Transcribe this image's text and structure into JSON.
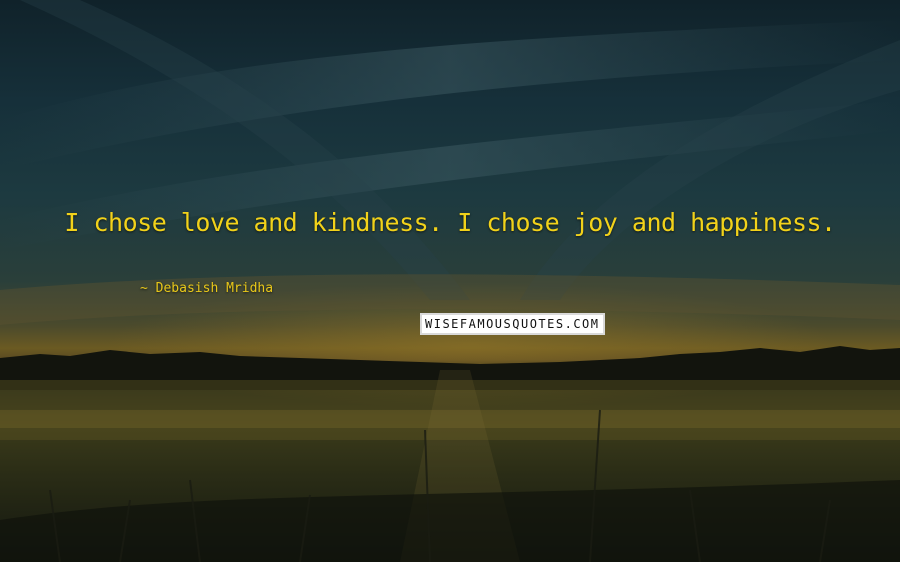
{
  "quote": {
    "text": "I chose love and kindness. I chose joy and happiness.",
    "author": "Debasish Mridha"
  },
  "watermark": {
    "text": "WISEFAMOUSQUOTES.COM"
  },
  "colors": {
    "quote_text": "#f2d21a",
    "author_text": "#e9c81a",
    "sky_dark": "#10222a",
    "horizon_glow": "#6b5a22"
  }
}
